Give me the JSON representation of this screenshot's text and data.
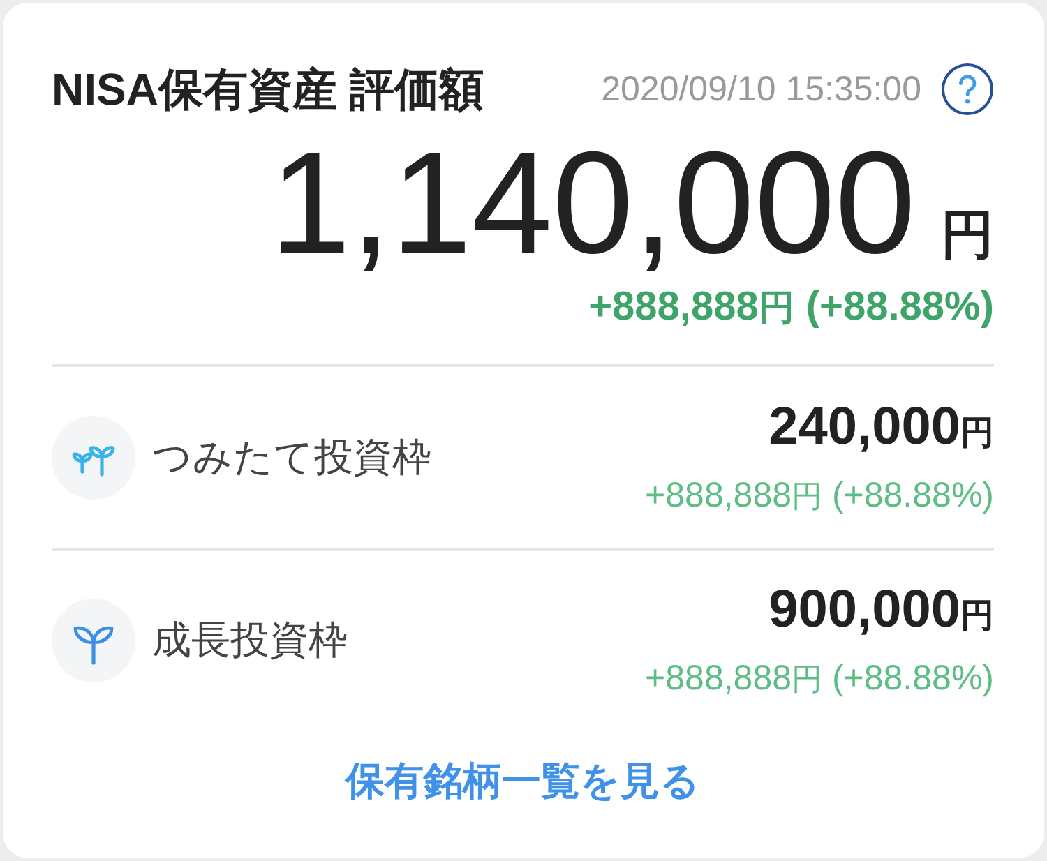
{
  "header": {
    "title": "NISA保有資産 評価額",
    "timestamp": "2020/09/10 15:35:00"
  },
  "total": {
    "amount": "1,140,000",
    "unit": "円",
    "change": {
      "amount": "+888,888",
      "unit": "円",
      "percent": "(+88.88%)"
    }
  },
  "accounts": [
    {
      "kind": "seedlings",
      "name": "つみたて投資枠",
      "amount": "240,000",
      "unit": "円",
      "change": {
        "amount": "+888,888",
        "unit": "円",
        "percent": "(+88.88%)"
      }
    },
    {
      "kind": "sprout",
      "name": "成長投資枠",
      "amount": "900,000",
      "unit": "円",
      "change": {
        "amount": "+888,888",
        "unit": "円",
        "percent": "(+88.88%)"
      }
    }
  ],
  "link": {
    "label": "保有銘柄一覧を見る"
  }
}
